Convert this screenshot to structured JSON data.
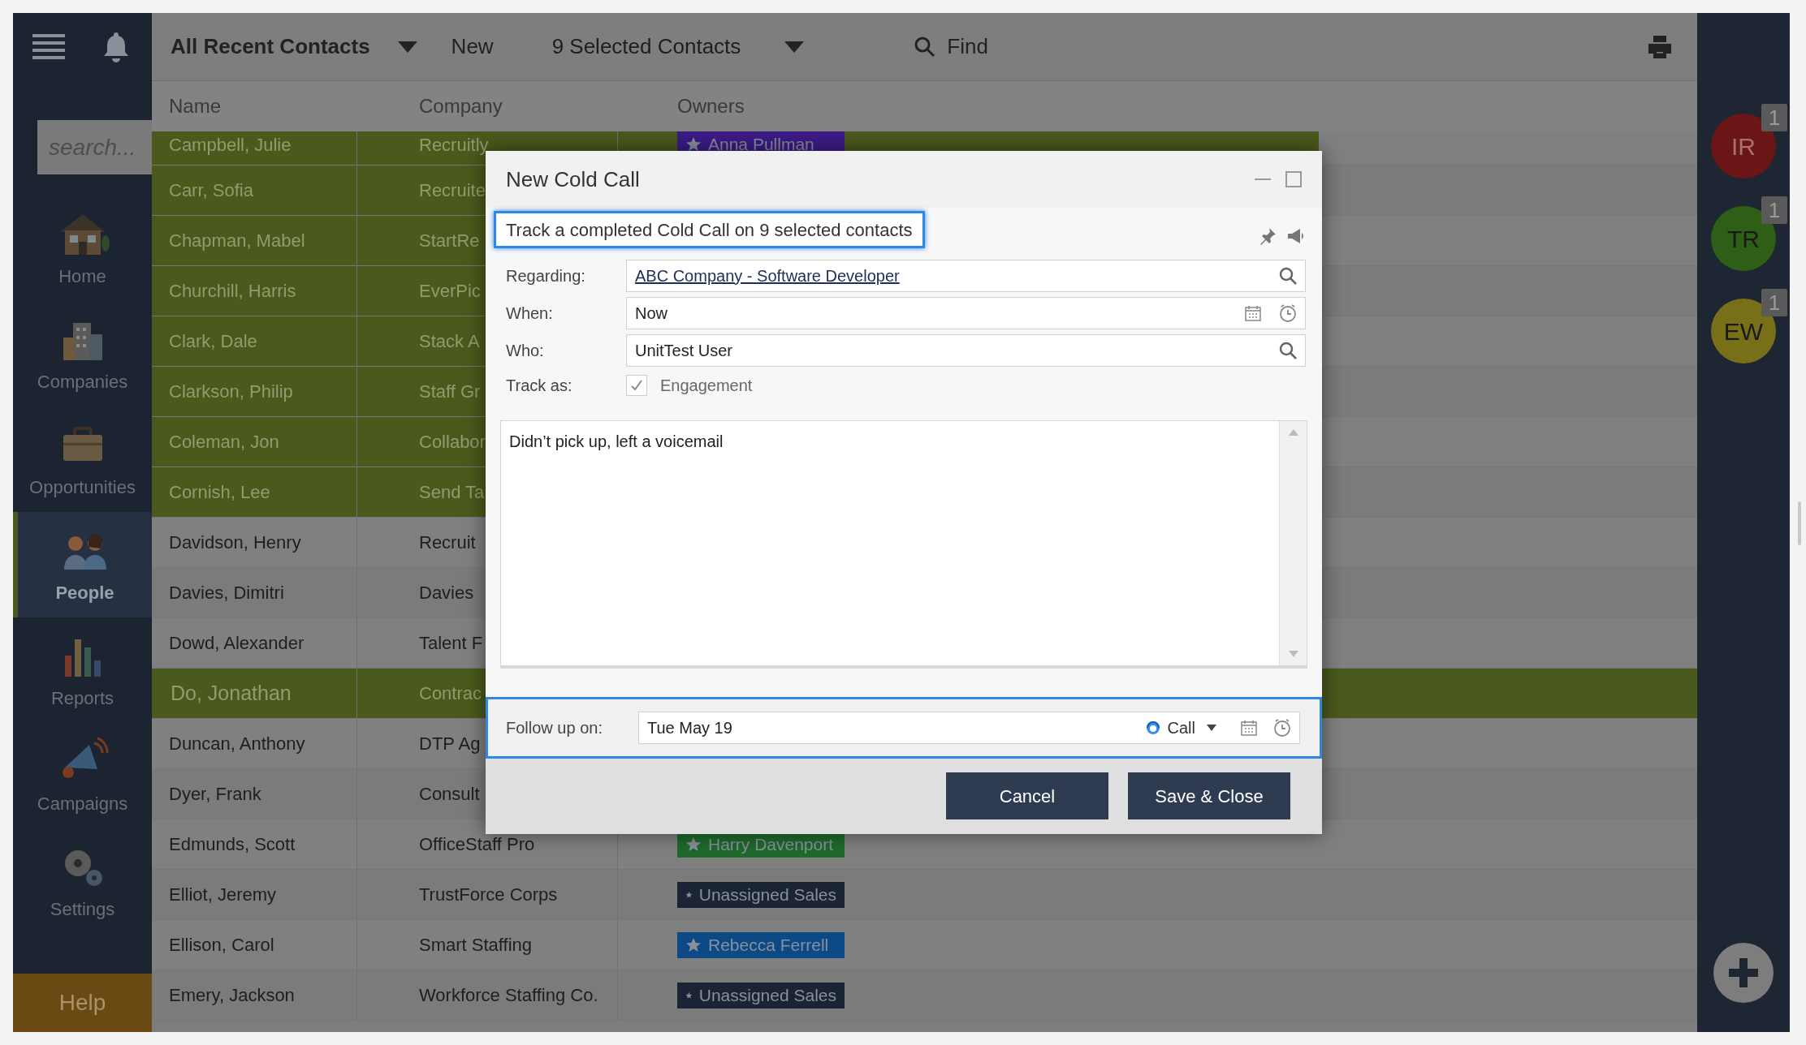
{
  "sidebar": {
    "search": {
      "placeholder": "search..."
    },
    "items": [
      {
        "label": "Home",
        "kind": "home",
        "selected": false
      },
      {
        "label": "Companies",
        "kind": "companies",
        "selected": false
      },
      {
        "label": "Opportunities",
        "kind": "opportunities",
        "selected": false
      },
      {
        "label": "People",
        "kind": "people",
        "selected": true
      },
      {
        "label": "Reports",
        "kind": "reports",
        "selected": false
      },
      {
        "label": "Campaigns",
        "kind": "campaigns",
        "selected": false
      },
      {
        "label": "Settings",
        "kind": "settings",
        "selected": false
      }
    ],
    "help": "Help"
  },
  "toolbar": {
    "view": "All Recent Contacts",
    "new": "New",
    "selection": "9 Selected Contacts",
    "find": "Find"
  },
  "table": {
    "columns": [
      "Name",
      "Company",
      "Owners"
    ],
    "rows": [
      {
        "name": "Campbell, Julie",
        "company": "Recruitly",
        "owner": {
          "label": "Anna Pullman",
          "color": "#3c1b87"
        },
        "selected": true,
        "current": false
      },
      {
        "name": "Carr,  Sofia",
        "company": "Recruite",
        "selected": true,
        "current": false
      },
      {
        "name": "Chapman, Mabel",
        "company": "StartRe",
        "selected": true,
        "current": false
      },
      {
        "name": "Churchill, Harris",
        "company": "EverPic",
        "selected": true,
        "current": false
      },
      {
        "name": "Clark, Dale",
        "company": "Stack A",
        "selected": true,
        "current": false
      },
      {
        "name": "Clarkson, Philip",
        "company": "Staff Gr",
        "selected": true,
        "current": false
      },
      {
        "name": "Coleman, Jon",
        "company": "Collabor",
        "selected": true,
        "current": false
      },
      {
        "name": "Cornish, Lee",
        "company": "Send Ta",
        "selected": true,
        "current": false
      },
      {
        "name": "Davidson, Henry",
        "company": "Recruit",
        "selected": false,
        "current": false
      },
      {
        "name": "Davies,  Dimitri",
        "company": "Davies",
        "selected": false,
        "current": false
      },
      {
        "name": "Dowd, Alexander",
        "company": "Talent F",
        "selected": false,
        "current": false
      },
      {
        "name": "Do, Jonathan",
        "company": "Contrac",
        "selected": true,
        "current": true
      },
      {
        "name": "Duncan, Anthony",
        "company": "DTP Ag",
        "selected": false,
        "current": false
      },
      {
        "name": "Dyer, Frank",
        "company": "Consult",
        "selected": false,
        "current": false
      },
      {
        "name": "Edmunds, Scott",
        "company": "OfficeStaff Pro",
        "owner": {
          "label": "Harry Davenport",
          "color": "#1f6a2c"
        },
        "selected": false,
        "current": false
      },
      {
        "name": "Elliot, Jeremy",
        "company": "TrustForce Corps",
        "owner": {
          "label": "Unassigned Sales",
          "color": "#1b2435"
        },
        "selected": false,
        "current": false
      },
      {
        "name": "Ellison, Carol",
        "company": "Smart Staffing",
        "owner": {
          "label": "Rebecca Ferrell",
          "color": "#0b4a86"
        },
        "selected": false,
        "current": false
      },
      {
        "name": "Emery, Jackson",
        "company": "Workforce Staffing Co.",
        "owner": {
          "label": "Unassigned Sales",
          "color": "#1b2435"
        },
        "selected": false,
        "current": false
      }
    ]
  },
  "dialog": {
    "title": "New Cold Call",
    "subtitle": "Track a completed Cold Call on 9 selected contacts",
    "fields": [
      {
        "label": "Regarding:",
        "value": "ABC Company - Software Developer",
        "kind": "link"
      },
      {
        "label": "When:",
        "value": "Now",
        "kind": "datetime"
      },
      {
        "label": "Who:",
        "value": "UnitTest User",
        "kind": "lookup"
      }
    ],
    "track_as": {
      "label": "Track as:",
      "option": "Engagement",
      "checked": true
    },
    "notes": "Didn’t pick up, left a voicemail",
    "follow_up": {
      "label": "Follow up on:",
      "value": "Tue May 19",
      "type": "Call"
    },
    "buttons": [
      "Cancel",
      "Save & Close"
    ]
  },
  "avatars": [
    {
      "initials": "IR",
      "color": "#6b1616",
      "count": "1"
    },
    {
      "initials": "TR",
      "color": "#2f5e17",
      "count": "1"
    },
    {
      "initials": "EW",
      "color": "#777019",
      "count": "1"
    }
  ]
}
